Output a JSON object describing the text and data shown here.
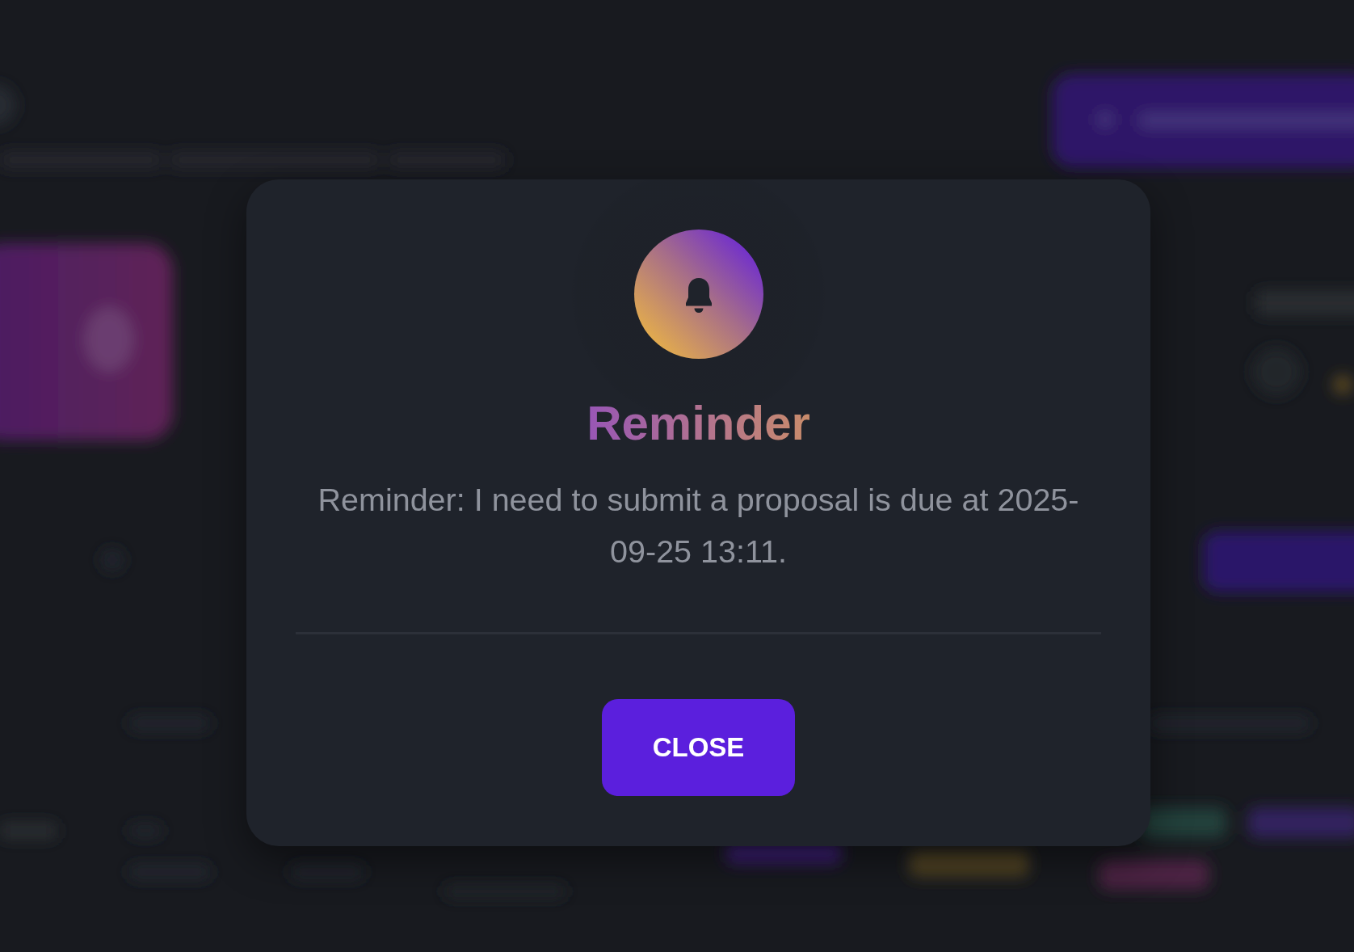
{
  "dialog": {
    "title": "Reminder",
    "message": "Reminder: I need to submit a proposal is due at 2025-09-25 13:11.",
    "close_button": {
      "label": "CLOSE"
    }
  }
}
